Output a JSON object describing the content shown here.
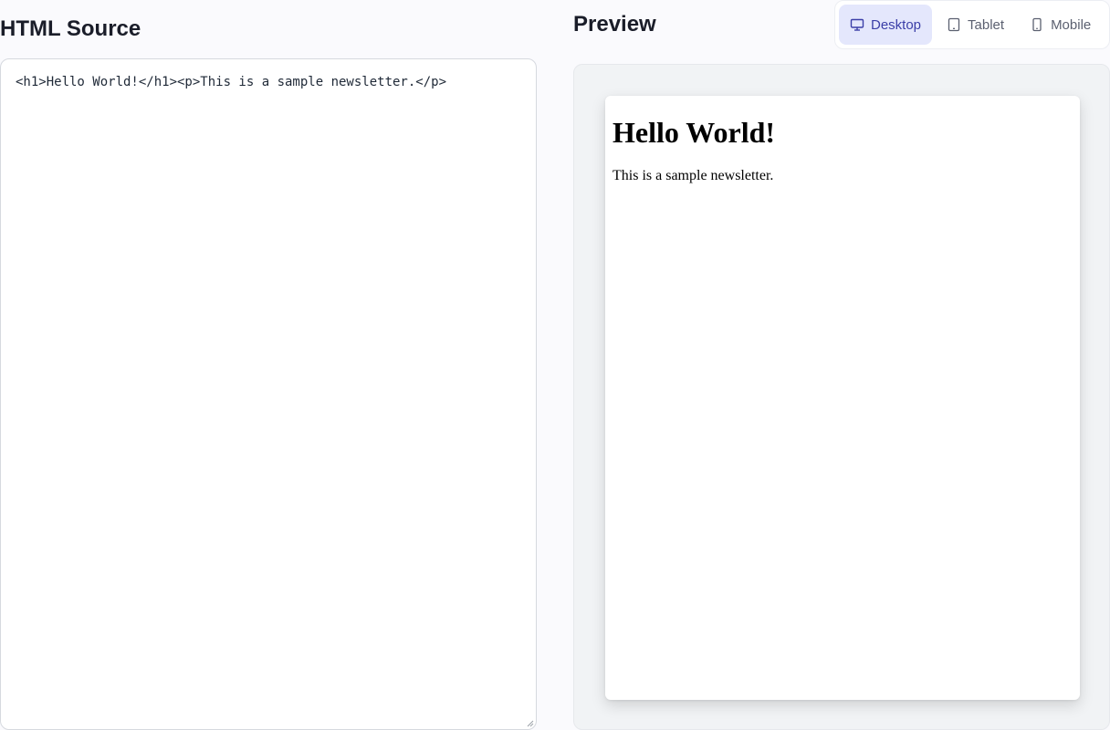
{
  "source": {
    "title": "HTML Source",
    "code": "<h1>Hello World!</h1><p>This is a sample newsletter.</p>"
  },
  "preview": {
    "title": "Preview",
    "devices": [
      {
        "label": "Desktop",
        "icon": "monitor-icon",
        "active": true
      },
      {
        "label": "Tablet",
        "icon": "tablet-icon",
        "active": false
      },
      {
        "label": "Mobile",
        "icon": "smartphone-icon",
        "active": false
      }
    ],
    "rendered": {
      "heading": "Hello World!",
      "paragraph": "This is a sample newsletter."
    }
  },
  "colors": {
    "accent": "#3b3fa8",
    "accent_bg": "#e4e7fc",
    "text": "#1a1d29"
  }
}
